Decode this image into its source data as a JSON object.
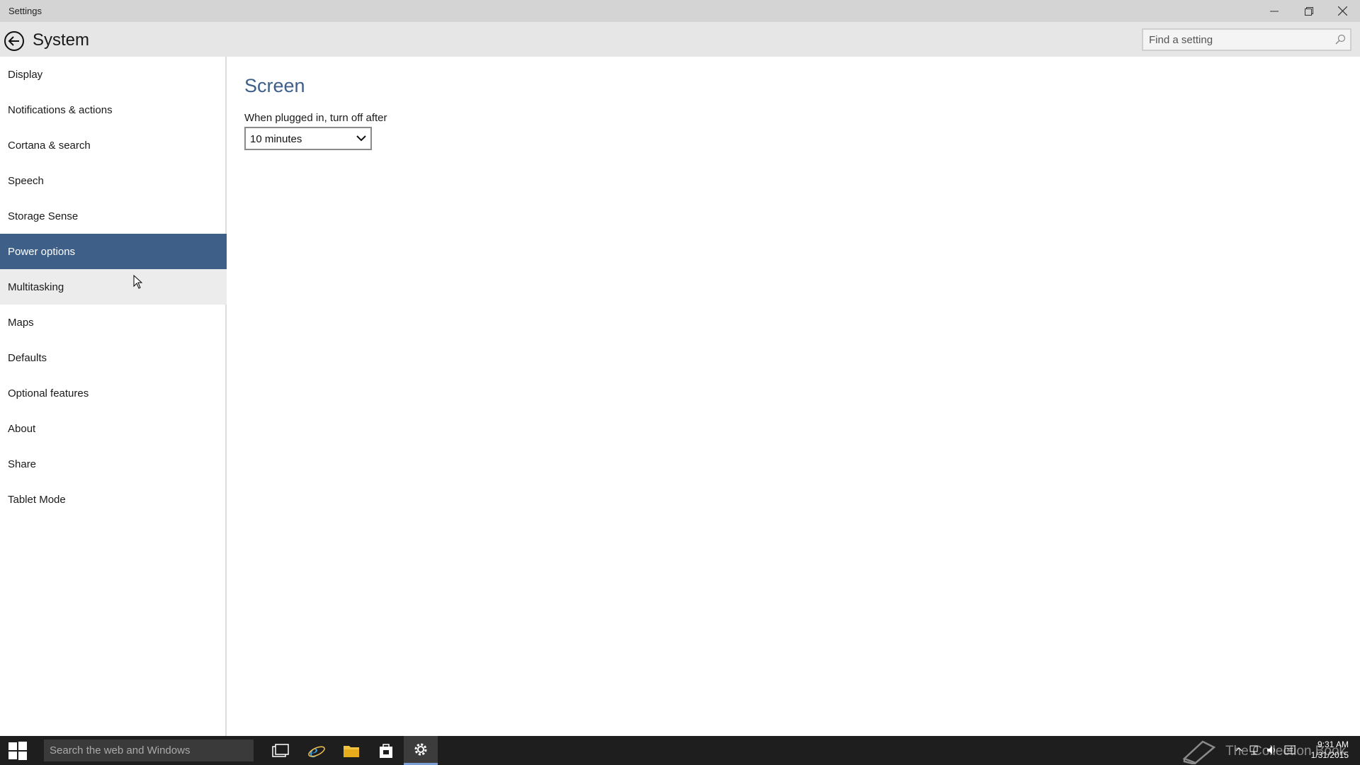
{
  "window": {
    "title": "Settings",
    "controls": {
      "minimize_icon": "minimize-icon",
      "restore_icon": "restore-icon",
      "close_icon": "close-icon"
    }
  },
  "header": {
    "title": "System",
    "search_placeholder": "Find a setting"
  },
  "sidebar": {
    "items": [
      {
        "label": "Display"
      },
      {
        "label": "Notifications & actions"
      },
      {
        "label": "Cortana & search"
      },
      {
        "label": "Speech"
      },
      {
        "label": "Storage Sense"
      },
      {
        "label": "Power options",
        "selected": true
      },
      {
        "label": "Multitasking",
        "hovered": true
      },
      {
        "label": "Maps"
      },
      {
        "label": "Defaults"
      },
      {
        "label": "Optional features"
      },
      {
        "label": "About"
      },
      {
        "label": "Share"
      },
      {
        "label": "Tablet Mode"
      }
    ]
  },
  "main": {
    "section_title": "Screen",
    "field_label": "When plugged in, turn off after",
    "dropdown_value": "10 minutes"
  },
  "taskbar": {
    "search_placeholder": "Search the web and Windows",
    "apps": [
      "task-view-icon",
      "internet-explorer-icon",
      "file-explorer-icon",
      "store-icon",
      "settings-icon"
    ],
    "watermark_text": "The Collection Book",
    "clock_time": "9:31 AM",
    "clock_date": "1/31/2015"
  },
  "colors": {
    "accent": "#3d5f88",
    "titlebar": "#d4d4d4",
    "header": "#e6e6e6",
    "taskbar": "#1e1e1e"
  }
}
